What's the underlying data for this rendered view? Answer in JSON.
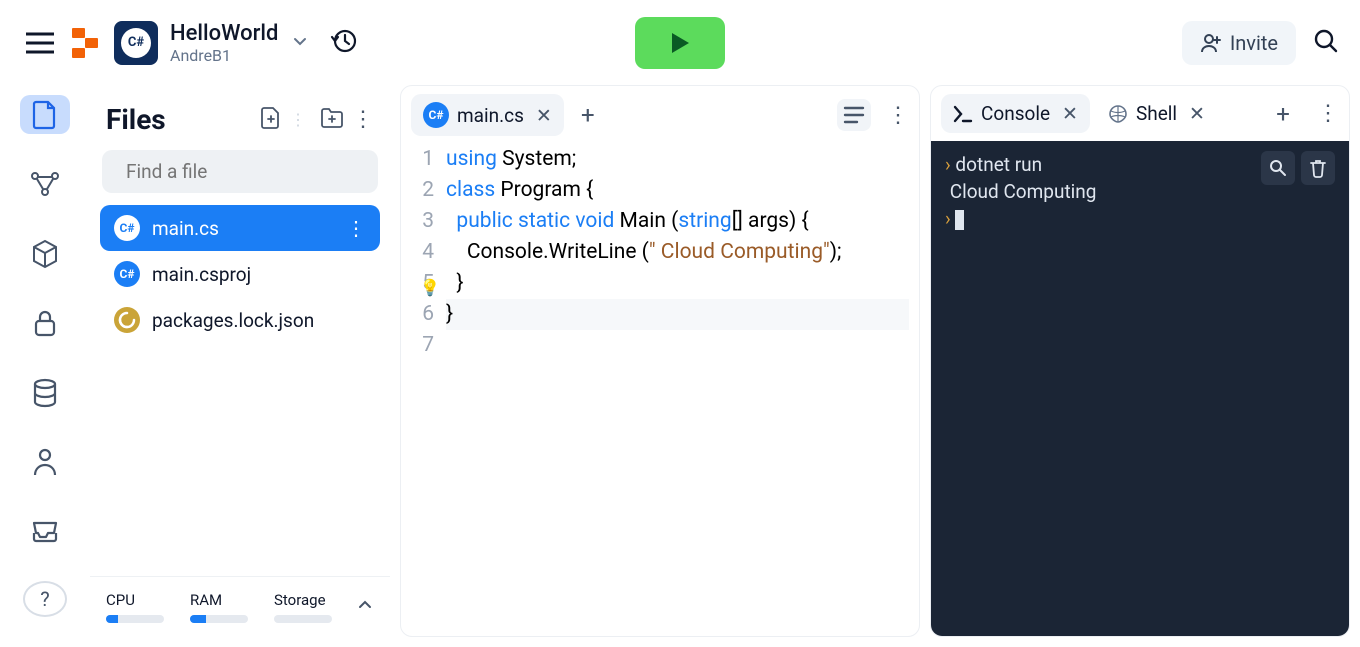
{
  "header": {
    "project_name": "HelloWorld",
    "owner": "AndreB1",
    "lang_badge": "C#",
    "invite_label": "Invite"
  },
  "sidebar": {
    "icons": [
      "file",
      "deploy",
      "package",
      "lock",
      "database",
      "user",
      "inbox"
    ]
  },
  "files": {
    "title": "Files",
    "search_placeholder": "Find a file",
    "items": [
      {
        "name": "main.cs",
        "type": "cs",
        "active": true
      },
      {
        "name": "main.csproj",
        "type": "cs",
        "active": false
      },
      {
        "name": "packages.lock.json",
        "type": "json",
        "active": false
      }
    ],
    "stats": [
      {
        "label": "CPU",
        "pct": 20
      },
      {
        "label": "RAM",
        "pct": 28
      },
      {
        "label": "Storage",
        "pct": 0
      }
    ]
  },
  "editor": {
    "tab": {
      "name": "main.cs"
    },
    "lines": [
      {
        "n": "1",
        "html": "<span class='kw'>using</span> System;"
      },
      {
        "n": "2",
        "html": ""
      },
      {
        "n": "3",
        "html": "<span class='kw'>class</span> Program {"
      },
      {
        "n": "4",
        "html": "  <span class='kw'>public</span> <span class='kw'>static</span> <span class='kw'>void</span> Main (<span class='type'>string</span>[] args) {"
      },
      {
        "n": "5",
        "html": "    Console.WriteLine (<span class='str'>\" Cloud Computing\"</span>);"
      },
      {
        "n": "6",
        "html": "  }",
        "bulb": true
      },
      {
        "n": "7",
        "html": "}",
        "current": true
      }
    ]
  },
  "console": {
    "tabs": [
      {
        "label": "Console",
        "active": true,
        "icon": "terminal"
      },
      {
        "label": "Shell",
        "active": false,
        "icon": "shell"
      }
    ],
    "lines": [
      {
        "prompt": true,
        "text": "dotnet run"
      },
      {
        "prompt": false,
        "text": " Cloud Computing"
      },
      {
        "prompt": true,
        "text": "",
        "cursor": true
      }
    ]
  }
}
